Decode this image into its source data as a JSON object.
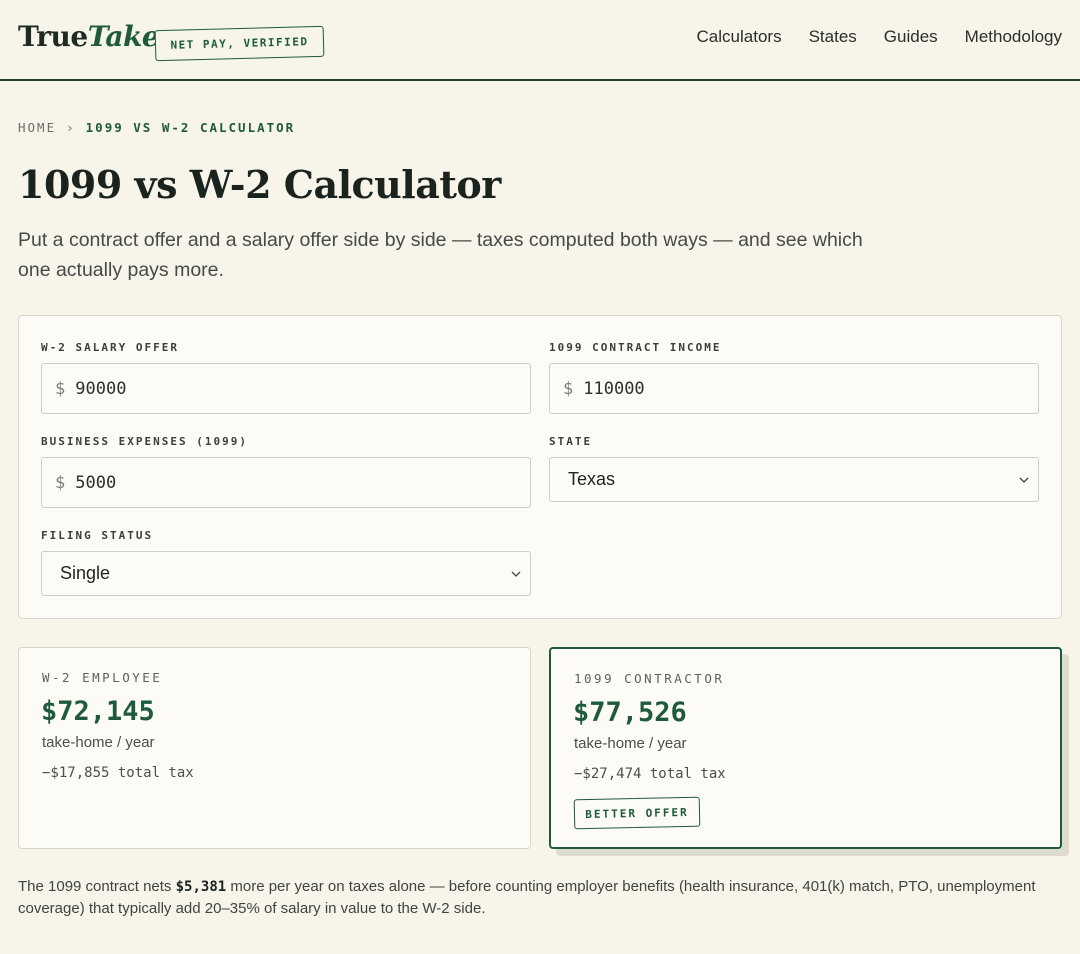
{
  "brand": {
    "name_part1": "True",
    "name_part2": "Take",
    "badge": "NET PAY, VERIFIED",
    "accent_color": "#1f5a3c"
  },
  "nav": {
    "items": [
      "Calculators",
      "States",
      "Guides",
      "Methodology"
    ]
  },
  "breadcrumb": {
    "home": "HOME",
    "separator": "›",
    "current": "1099 VS W-2 CALCULATOR"
  },
  "page": {
    "title": "1099 vs W-2 Calculator",
    "subtitle": "Put a contract offer and a salary offer side by side — taxes computed both ways — and see which one actually pays more."
  },
  "form": {
    "w2_salary": {
      "label": "W-2 SALARY OFFER",
      "currency": "$",
      "value": "90000"
    },
    "contract_income": {
      "label": "1099 CONTRACT INCOME",
      "currency": "$",
      "value": "110000"
    },
    "business_expenses": {
      "label": "BUSINESS EXPENSES (1099)",
      "currency": "$",
      "value": "5000"
    },
    "state": {
      "label": "STATE",
      "selected": "Texas"
    },
    "filing_status": {
      "label": "FILING STATUS",
      "selected": "Single"
    }
  },
  "results": {
    "w2": {
      "label": "W-2 EMPLOYEE",
      "amount": "$72,145",
      "period": "take-home / year",
      "tax": "−$17,855 total tax"
    },
    "contractor": {
      "label": "1099 CONTRACTOR",
      "amount": "$77,526",
      "period": "take-home / year",
      "tax": "−$27,474 total tax",
      "badge": "BETTER OFFER"
    }
  },
  "footnote": {
    "prefix": "The 1099 contract nets ",
    "difference": "$5,381",
    "suffix": " more per year on taxes alone — before counting employer benefits (health insurance, 401(k) match, PTO, unemployment coverage) that typically add 20–35% of salary in value to the W-2 side."
  }
}
